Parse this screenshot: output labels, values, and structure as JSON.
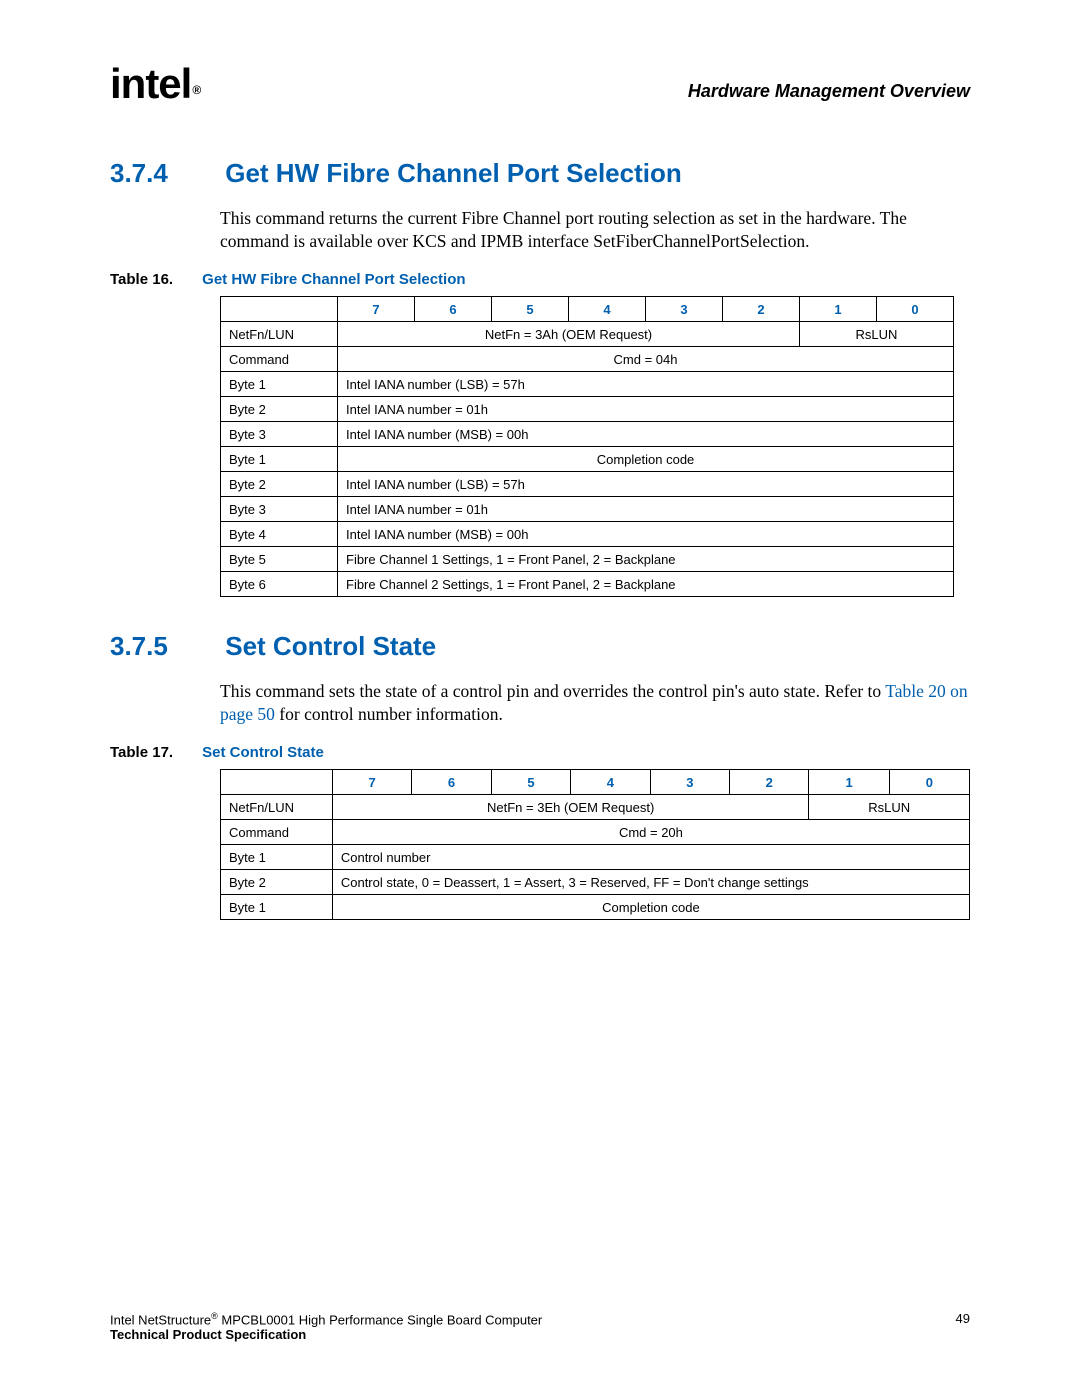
{
  "running_head": "Hardware Management Overview",
  "logo_text": "intel",
  "logo_reg": "®",
  "sections": [
    {
      "num": "3.7.4",
      "title": "Get HW Fibre Channel Port Selection",
      "para": "This command returns the current Fibre Channel port routing selection as set in the hardware. The command is available over KCS and IPMB interface SetFiberChannelPortSelection.",
      "table_label": "Table 16.",
      "table_title": "Get HW Fibre Channel Port Selection"
    },
    {
      "num": "3.7.5",
      "title": "Set Control State",
      "para_a": "This command sets the state of a control pin and overrides the control pin's auto state. Refer to ",
      "xref": "Table 20 on page 50",
      "para_b": " for control number information.",
      "table_label": "Table 17.",
      "table_title": "Set Control State"
    }
  ],
  "bits": [
    "7",
    "6",
    "5",
    "4",
    "3",
    "2",
    "1",
    "0"
  ],
  "table16_col_widths": [
    60,
    60,
    60,
    60,
    60,
    60,
    60,
    60
  ],
  "table17_col_widths": [
    72,
    72,
    72,
    72,
    72,
    72,
    72,
    72
  ],
  "table16_rows": [
    {
      "label": "NetFn/LUN",
      "cells": [
        {
          "span": 6,
          "align": "center",
          "text": "NetFn = 3Ah (OEM Request)"
        },
        {
          "span": 2,
          "align": "center",
          "text": "RsLUN"
        }
      ]
    },
    {
      "label": "Command",
      "cells": [
        {
          "span": 8,
          "align": "center",
          "text": "Cmd = 04h"
        }
      ]
    },
    {
      "label": "Byte 1",
      "cells": [
        {
          "span": 8,
          "align": "left",
          "text": "Intel IANA number (LSB) = 57h"
        }
      ]
    },
    {
      "label": "Byte 2",
      "cells": [
        {
          "span": 8,
          "align": "left",
          "text": "Intel IANA number = 01h"
        }
      ]
    },
    {
      "label": "Byte 3",
      "cells": [
        {
          "span": 8,
          "align": "left",
          "text": "Intel IANA number (MSB) = 00h"
        }
      ]
    },
    {
      "label": "Byte 1",
      "cells": [
        {
          "span": 8,
          "align": "center",
          "text": "Completion code"
        }
      ]
    },
    {
      "label": "Byte 2",
      "cells": [
        {
          "span": 8,
          "align": "left",
          "text": "Intel IANA number (LSB) = 57h"
        }
      ]
    },
    {
      "label": "Byte 3",
      "cells": [
        {
          "span": 8,
          "align": "left",
          "text": "Intel IANA number = 01h"
        }
      ]
    },
    {
      "label": "Byte 4",
      "cells": [
        {
          "span": 8,
          "align": "left",
          "text": "Intel IANA number (MSB) = 00h"
        }
      ]
    },
    {
      "label": "Byte 5",
      "cells": [
        {
          "span": 8,
          "align": "left",
          "text": "Fibre Channel 1 Settings, 1 = Front Panel, 2 = Backplane"
        }
      ]
    },
    {
      "label": "Byte 6",
      "cells": [
        {
          "span": 8,
          "align": "left",
          "text": "Fibre Channel 2 Settings, 1 = Front Panel, 2 = Backplane"
        }
      ]
    }
  ],
  "table17_rows": [
    {
      "label": "NetFn/LUN",
      "cells": [
        {
          "span": 6,
          "align": "center",
          "text": "NetFn = 3Eh (OEM Request)"
        },
        {
          "span": 2,
          "align": "center",
          "text": "RsLUN"
        }
      ]
    },
    {
      "label": "Command",
      "cells": [
        {
          "span": 8,
          "align": "center",
          "text": "Cmd = 20h"
        }
      ]
    },
    {
      "label": "Byte 1",
      "cells": [
        {
          "span": 8,
          "align": "left",
          "text": "Control number"
        }
      ]
    },
    {
      "label": "Byte 2",
      "cells": [
        {
          "span": 8,
          "align": "left",
          "text": "Control state, 0 = Deassert, 1 = Assert, 3 = Reserved, FF = Don't change settings"
        }
      ]
    },
    {
      "label": "Byte 1",
      "cells": [
        {
          "span": 8,
          "align": "center",
          "text": "Completion code"
        }
      ]
    }
  ],
  "footer": {
    "line1a": "Intel NetStructure",
    "reg": "®",
    "line1b": " MPCBL0001 High Performance Single Board Computer",
    "line2": "Technical Product Specification",
    "page_number": "49"
  }
}
